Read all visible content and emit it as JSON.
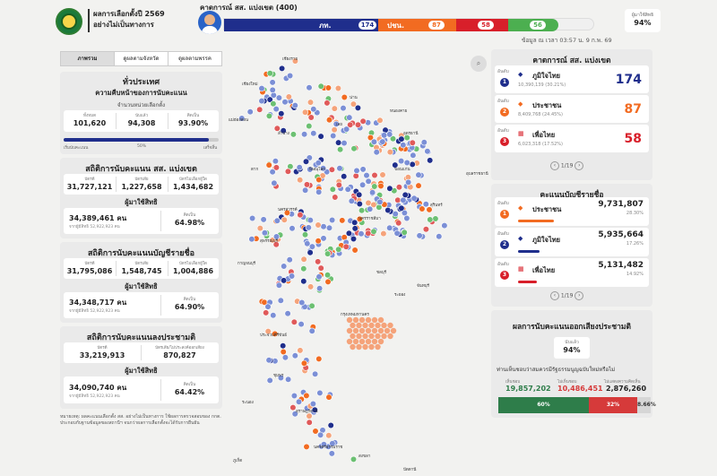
{
  "header": {
    "title_line1": "ผลการเลือกตั้งปี 2569",
    "title_line2": "อย่างไม่เป็นทางการ",
    "projection_title": "คาดการณ์ สส. แบ่งเขต (400)",
    "bar": [
      {
        "party": "ภท.",
        "seats": "174",
        "color": "#1f2e8c"
      },
      {
        "party": "ปชน.",
        "seats": "87",
        "color": "#f26b21"
      },
      {
        "party": "",
        "seats": "58",
        "color": "#d81f2a"
      },
      {
        "party": "",
        "seats": "56",
        "color": "#4caf50"
      }
    ],
    "turnout_label": "ผู้มาใช้สิทธิ",
    "turnout_value": "94%",
    "updated": "ข้อมูล ณ เวลา 03:57 น. 9 ก.พ. 69"
  },
  "tabs": [
    "ภาพรวม",
    "ดูผลตามจังหวัด",
    "ดูผลตามพรรค"
  ],
  "overview": {
    "title": "ทั่วประเทศ",
    "subtitle": "ความคืบหน้าของการนับคะแนน",
    "units_label": "จำนวนหน่วยเลือกตั้ง",
    "stats": [
      {
        "label": "ทั้งหมด",
        "value": "101,620"
      },
      {
        "label": "นับแล้ว",
        "value": "94,308"
      },
      {
        "label": "คิดเป็น",
        "value": "93.90%"
      }
    ],
    "progress": 0.939,
    "progress_labels": [
      "เริ่มนับคะแนน",
      "50%",
      "เสร็จสิ้น"
    ]
  },
  "constituency": {
    "title": "สถิติการนับคะแนน สส. แบ่งเขต",
    "stats": [
      {
        "label": "บัตรดี",
        "value": "31,727,121"
      },
      {
        "label": "บัตรเสีย",
        "value": "1,227,658"
      },
      {
        "label": "บัตรไม่เลือกผู้ใด",
        "value": "1,434,682"
      }
    ],
    "voters_title": "ผู้มาใช้สิทธิ",
    "voters": "34,389,461 คน",
    "voters_total": "จากผู้มีสิทธิ 52,922,923 คน",
    "pct_label": "คิดเป็น",
    "pct": "64.98%"
  },
  "partylist": {
    "title": "สถิติการนับคะแนนบัญชีรายชื่อ",
    "stats": [
      {
        "label": "บัตรดี",
        "value": "31,795,086"
      },
      {
        "label": "บัตรเสีย",
        "value": "1,548,745"
      },
      {
        "label": "บัตรไม่เลือกผู้ใด",
        "value": "1,004,886"
      }
    ],
    "voters_title": "ผู้มาใช้สิทธิ",
    "voters": "34,348,717 คน",
    "voters_total": "จากผู้มีสิทธิ 52,922,923 คน",
    "pct_label": "คิดเป็น",
    "pct": "64.90%"
  },
  "referendum_stats": {
    "title": "สถิติการนับคะแนนลงประชามติ",
    "stats": [
      {
        "label": "บัตรดี",
        "value": "33,219,913"
      },
      {
        "label": "บัตรเสีย/ไม่ประสงค์ออกเสียง",
        "value": "870,827"
      }
    ],
    "voters_title": "ผู้มาใช้สิทธิ",
    "voters": "34,090,740 คน",
    "voters_total": "จากผู้มีสิทธิ 52,922,923 คน",
    "pct_label": "คิดเป็น",
    "pct": "64.42%"
  },
  "note": "หมายเหตุ: ผลคะแนนเลือกตั้ง สส. อย่างไม่เป็นทางการ ใช้ผลการตรวจสอบของ กกต. ประกอบกับฐานข้อมูลของสถานีฯ จนกว่าผลการเลือกตั้งจะได้รับการยืนยัน",
  "map": {
    "provinces": [
      "เชียงราย",
      "เชียงใหม่",
      "แม่ฮ่องสอน",
      "น่าน",
      "ลำปาง",
      "ตาก",
      "พิษณุโลก",
      "เลย",
      "หนองคาย",
      "อุดรธานี",
      "ขอนแก่น",
      "นครราชสีมา",
      "สุรินทร์",
      "อุบลราชธานี",
      "นครสวรรค์",
      "สุพรรณบุรี",
      "กาญจนบุรี",
      "ชลบุรี",
      "ระยอง",
      "จันทบุรี",
      "ประจวบคีรีขันธ์",
      "ชุมพร",
      "ระนอง",
      "สุราษฎร์ธานี",
      "ภูเก็ต",
      "นครศรีธรรมราช",
      "สงขลา",
      "ปัตตานี",
      "นราธิวาส",
      "กรุงเทพมหานคร"
    ]
  },
  "projection": {
    "title": "คาดการณ์ สส. แบ่งเขต",
    "rank_label": "อันดับ",
    "rows": [
      {
        "rank": "1",
        "name": "ภูมิใจไทย",
        "votes": "10,390,139 (30.21%)",
        "seats": "174",
        "color": "#1f2e8c"
      },
      {
        "rank": "2",
        "name": "ประชาชน",
        "votes": "8,409,768 (24.45%)",
        "seats": "87",
        "color": "#f26b21"
      },
      {
        "rank": "3",
        "name": "เพื่อไทย",
        "votes": "6,023,318 (17.52%)",
        "seats": "58",
        "color": "#d81f2a"
      }
    ],
    "pager": "1/19"
  },
  "partylist_rank": {
    "title": "คะแนนบัญชีรายชื่อ",
    "rank_label": "อันดับ",
    "rows": [
      {
        "rank": "1",
        "name": "ประชาชน",
        "votes": "9,731,807",
        "pct": "28.30%",
        "share": 0.283,
        "color": "#f26b21"
      },
      {
        "rank": "2",
        "name": "ภูมิใจไทย",
        "votes": "5,935,664",
        "pct": "17.26%",
        "share": 0.1726,
        "color": "#1f2e8c"
      },
      {
        "rank": "3",
        "name": "เพื่อไทย",
        "votes": "5,131,482",
        "pct": "14.92%",
        "share": 0.1492,
        "color": "#d81f2a"
      }
    ],
    "pager": "1/19"
  },
  "referendum": {
    "title": "ผลการนับคะแนนออกเสียงประชามติ",
    "counted_label": "นับแล้ว",
    "counted": "94%",
    "question": "ท่านเห็นชอบว่าสมควรมีรัฐธรรมนูญฉบับใหม่หรือไม่",
    "labels": [
      "เห็นชอบ",
      "ไม่เห็นชอบ",
      "ไม่แสดงความคิดเห็น"
    ],
    "values": [
      "19,857,202",
      "10,486,451",
      "2,876,260"
    ],
    "bar": [
      {
        "label": "60%",
        "share": 0.6,
        "color": "#2e7d4a"
      },
      {
        "label": "32%",
        "share": 0.32,
        "color": "#d63a3a"
      },
      {
        "label": "8.66%",
        "share": 0.0866,
        "color": "#d6d6d6"
      }
    ]
  }
}
